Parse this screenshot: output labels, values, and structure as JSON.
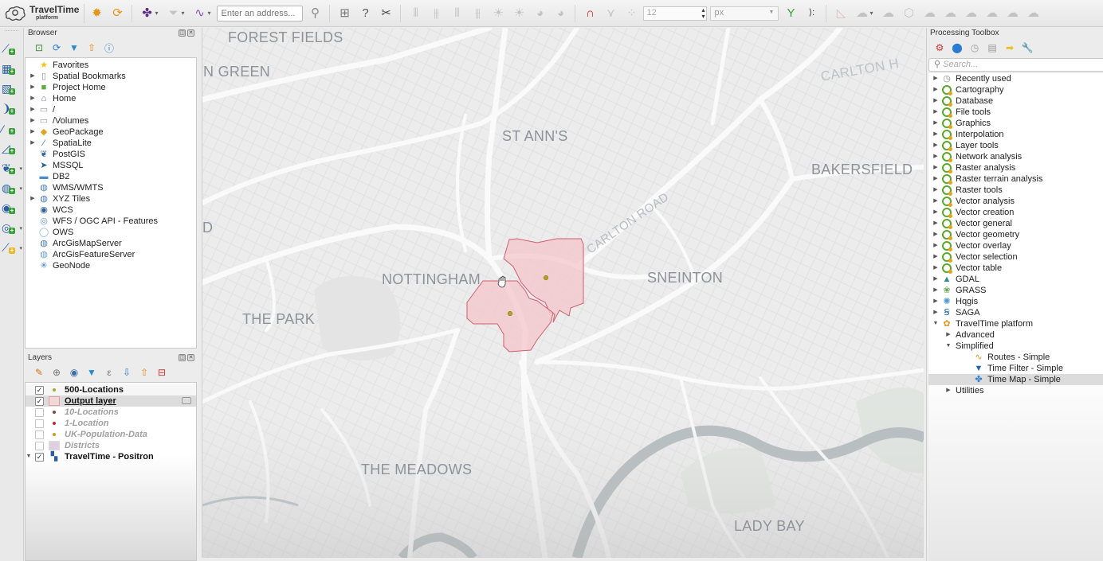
{
  "toolbar": {
    "brand_name": "TravelTime",
    "brand_sub": "platform",
    "address_placeholder": "Enter an address...",
    "symbol_size_value": "12",
    "symbol_unit": "px",
    "buttons": [
      {
        "name": "traveltime-settings-icon",
        "glyph": "✹",
        "color": "#e8941a"
      },
      {
        "name": "traveltime-refresh-icon",
        "glyph": "⟳",
        "color": "#e8941a"
      },
      {
        "name": "time-map-icon",
        "glyph": "✤",
        "color": "#5b2a86"
      },
      {
        "name": "time-filter-icon",
        "glyph": "▼",
        "color": "#9aa0a6"
      },
      {
        "name": "routes-icon",
        "glyph": "∿",
        "color": "#8a4fbf"
      }
    ]
  },
  "vertical_toolbar": [
    {
      "name": "add-vector-layer-icon",
      "glyph": "⟋"
    },
    {
      "name": "add-raster-layer-icon",
      "glyph": "▦"
    },
    {
      "name": "add-mesh-layer-icon",
      "glyph": "▧"
    },
    {
      "name": "add-delimited-text-icon",
      "glyph": "❩"
    },
    {
      "name": "add-spatialite-layer-icon",
      "glyph": "⁄"
    },
    {
      "name": "add-virtual-layer-icon",
      "glyph": "◿"
    },
    {
      "name": "add-postgis-layer-icon",
      "glyph": "❦"
    },
    {
      "name": "add-wms-layer-icon",
      "glyph": "◍"
    },
    {
      "name": "add-wcs-layer-icon",
      "glyph": "◉"
    },
    {
      "name": "add-wfs-layer-icon",
      "glyph": "◎"
    },
    {
      "name": "new-shapefile-layer-icon",
      "glyph": "⟋"
    }
  ],
  "browser": {
    "title": "Browser",
    "items": [
      {
        "label": "Favorites",
        "icon": "star-icon",
        "glyph": "★",
        "color": "#f2c31a",
        "expandable": false
      },
      {
        "label": "Spatial Bookmarks",
        "icon": "bookmark-icon",
        "glyph": "▯",
        "color": "#8a8f99",
        "expandable": true
      },
      {
        "label": "Project Home",
        "icon": "project-home-icon",
        "glyph": "■",
        "color": "#5cae3a",
        "expandable": true
      },
      {
        "label": "Home",
        "icon": "home-folder-icon",
        "glyph": "⌂",
        "color": "#777",
        "expandable": true
      },
      {
        "label": "/",
        "icon": "folder-icon",
        "glyph": "▭",
        "color": "#999",
        "expandable": true
      },
      {
        "label": "/Volumes",
        "icon": "folder-icon",
        "glyph": "▭",
        "color": "#999",
        "expandable": true
      },
      {
        "label": "GeoPackage",
        "icon": "geopackage-icon",
        "glyph": "◆",
        "color": "#e0a424",
        "expandable": true
      },
      {
        "label": "SpatiaLite",
        "icon": "spatialite-icon",
        "glyph": "⁄",
        "color": "#3a6ea5",
        "expandable": true
      },
      {
        "label": "PostGIS",
        "icon": "postgis-icon",
        "glyph": "❦",
        "color": "#336699",
        "expandable": false
      },
      {
        "label": "MSSQL",
        "icon": "mssql-icon",
        "glyph": "➤",
        "color": "#2d5f99",
        "expandable": false
      },
      {
        "label": "DB2",
        "icon": "db2-icon",
        "glyph": "▬",
        "color": "#4a8cd0",
        "expandable": false
      },
      {
        "label": "WMS/WMTS",
        "icon": "wms-icon",
        "glyph": "◍",
        "color": "#4a7cb5",
        "expandable": false
      },
      {
        "label": "XYZ Tiles",
        "icon": "xyz-tiles-icon",
        "glyph": "◍",
        "color": "#4a7cb5",
        "expandable": true
      },
      {
        "label": "WCS",
        "icon": "wcs-icon",
        "glyph": "◉",
        "color": "#2d5f99",
        "expandable": false
      },
      {
        "label": "WFS / OGC API - Features",
        "icon": "wfs-icon",
        "glyph": "◎",
        "color": "#6a9bd1",
        "expandable": false
      },
      {
        "label": "OWS",
        "icon": "ows-icon",
        "glyph": "◯",
        "color": "#8fb3dd",
        "expandable": false
      },
      {
        "label": "ArcGisMapServer",
        "icon": "arcgis-map-server-icon",
        "glyph": "◍",
        "color": "#4a7cb5",
        "expandable": false
      },
      {
        "label": "ArcGisFeatureServer",
        "icon": "arcgis-feature-server-icon",
        "glyph": "◍",
        "color": "#6a9bd1",
        "expandable": false
      },
      {
        "label": "GeoNode",
        "icon": "geonode-icon",
        "glyph": "✳",
        "color": "#3b7ed1",
        "expandable": false
      }
    ]
  },
  "layers": {
    "title": "Layers",
    "items": [
      {
        "label": "500-Locations",
        "checked": true,
        "symbol": "dot",
        "color": "#a8a82a",
        "active": true,
        "selected": false,
        "expandable": false
      },
      {
        "label": "Output layer",
        "checked": true,
        "symbol": "polygon",
        "color": "#f3d6d8",
        "active": true,
        "selected": true,
        "expandable": false
      },
      {
        "label": "10-Locations",
        "checked": false,
        "symbol": "dot",
        "color": "#7a4a3a",
        "active": false,
        "selected": false,
        "expandable": false
      },
      {
        "label": "1-Location",
        "checked": false,
        "symbol": "dot",
        "color": "#b03030",
        "active": false,
        "selected": false,
        "expandable": false
      },
      {
        "label": "UK-Population-Data",
        "checked": false,
        "symbol": "dot",
        "color": "#c8a020",
        "active": false,
        "selected": false,
        "expandable": false
      },
      {
        "label": "Districts",
        "checked": false,
        "symbol": "polygon",
        "color": "#e0cfe0",
        "active": false,
        "selected": false,
        "expandable": false
      },
      {
        "label": "TravelTime - Positron",
        "checked": true,
        "symbol": "raster",
        "color": "#2d5f99",
        "active": true,
        "selected": false,
        "expandable": true
      }
    ]
  },
  "map": {
    "labels": [
      {
        "text": "FOREST FIELDS"
      },
      {
        "text": "N GREEN"
      },
      {
        "text": "ST ANN'S"
      },
      {
        "text": "CARLTON H"
      },
      {
        "text": "BAKERSFIELD"
      },
      {
        "text": "CARLTON ROAD"
      },
      {
        "text": "D"
      },
      {
        "text": "NOTTINGHAM"
      },
      {
        "text": "SNEINTON"
      },
      {
        "text": "THE PARK"
      },
      {
        "text": "THE MEADOWS"
      },
      {
        "text": "LADY BAY"
      }
    ],
    "isochrone_fill": "#f4c6cb",
    "isochrone_stroke": "#d0606c",
    "location_point_color": "#b5a21e"
  },
  "processing": {
    "title": "Processing Toolbox",
    "search_placeholder": "Search...",
    "providers": [
      {
        "label": "Recently used",
        "icon": "clock-icon",
        "expandable": true,
        "depth": 0
      },
      {
        "label": "Cartography",
        "icon": "qgis-icon",
        "expandable": true,
        "depth": 0
      },
      {
        "label": "Database",
        "icon": "qgis-icon",
        "expandable": true,
        "depth": 0
      },
      {
        "label": "File tools",
        "icon": "qgis-icon",
        "expandable": true,
        "depth": 0
      },
      {
        "label": "Graphics",
        "icon": "qgis-icon",
        "expandable": true,
        "depth": 0
      },
      {
        "label": "Interpolation",
        "icon": "qgis-icon",
        "expandable": true,
        "depth": 0
      },
      {
        "label": "Layer tools",
        "icon": "qgis-icon",
        "expandable": true,
        "depth": 0
      },
      {
        "label": "Network analysis",
        "icon": "qgis-icon",
        "expandable": true,
        "depth": 0
      },
      {
        "label": "Raster analysis",
        "icon": "qgis-icon",
        "expandable": true,
        "depth": 0
      },
      {
        "label": "Raster terrain analysis",
        "icon": "qgis-icon",
        "expandable": true,
        "depth": 0
      },
      {
        "label": "Raster tools",
        "icon": "qgis-icon",
        "expandable": true,
        "depth": 0
      },
      {
        "label": "Vector analysis",
        "icon": "qgis-icon",
        "expandable": true,
        "depth": 0
      },
      {
        "label": "Vector creation",
        "icon": "qgis-icon",
        "expandable": true,
        "depth": 0
      },
      {
        "label": "Vector general",
        "icon": "qgis-icon",
        "expandable": true,
        "depth": 0
      },
      {
        "label": "Vector geometry",
        "icon": "qgis-icon",
        "expandable": true,
        "depth": 0
      },
      {
        "label": "Vector overlay",
        "icon": "qgis-icon",
        "expandable": true,
        "depth": 0
      },
      {
        "label": "Vector selection",
        "icon": "qgis-icon",
        "expandable": true,
        "depth": 0
      },
      {
        "label": "Vector table",
        "icon": "qgis-icon",
        "expandable": true,
        "depth": 0
      },
      {
        "label": "GDAL",
        "icon": "gdal-icon",
        "expandable": true,
        "depth": 0
      },
      {
        "label": "GRASS",
        "icon": "grass-icon",
        "expandable": true,
        "depth": 0
      },
      {
        "label": "Hqgis",
        "icon": "hqgis-icon",
        "expandable": true,
        "depth": 0
      },
      {
        "label": "SAGA",
        "icon": "saga-icon",
        "expandable": true,
        "depth": 0
      },
      {
        "label": "TravelTime platform",
        "icon": "traveltime-icon",
        "expandable": true,
        "expanded": true,
        "depth": 0
      },
      {
        "label": "Advanced",
        "icon": "",
        "expandable": true,
        "depth": 1
      },
      {
        "label": "Simplified",
        "icon": "",
        "expandable": true,
        "expanded": true,
        "depth": 1
      },
      {
        "label": "Routes - Simple",
        "icon": "routes-icon",
        "expandable": false,
        "depth": 2
      },
      {
        "label": "Time Filter - Simple",
        "icon": "time-filter-icon",
        "expandable": false,
        "depth": 2
      },
      {
        "label": "Time Map - Simple",
        "icon": "time-map-icon",
        "expandable": false,
        "depth": 2,
        "selected": true
      },
      {
        "label": "Utilities",
        "icon": "",
        "expandable": true,
        "depth": 1
      }
    ]
  }
}
